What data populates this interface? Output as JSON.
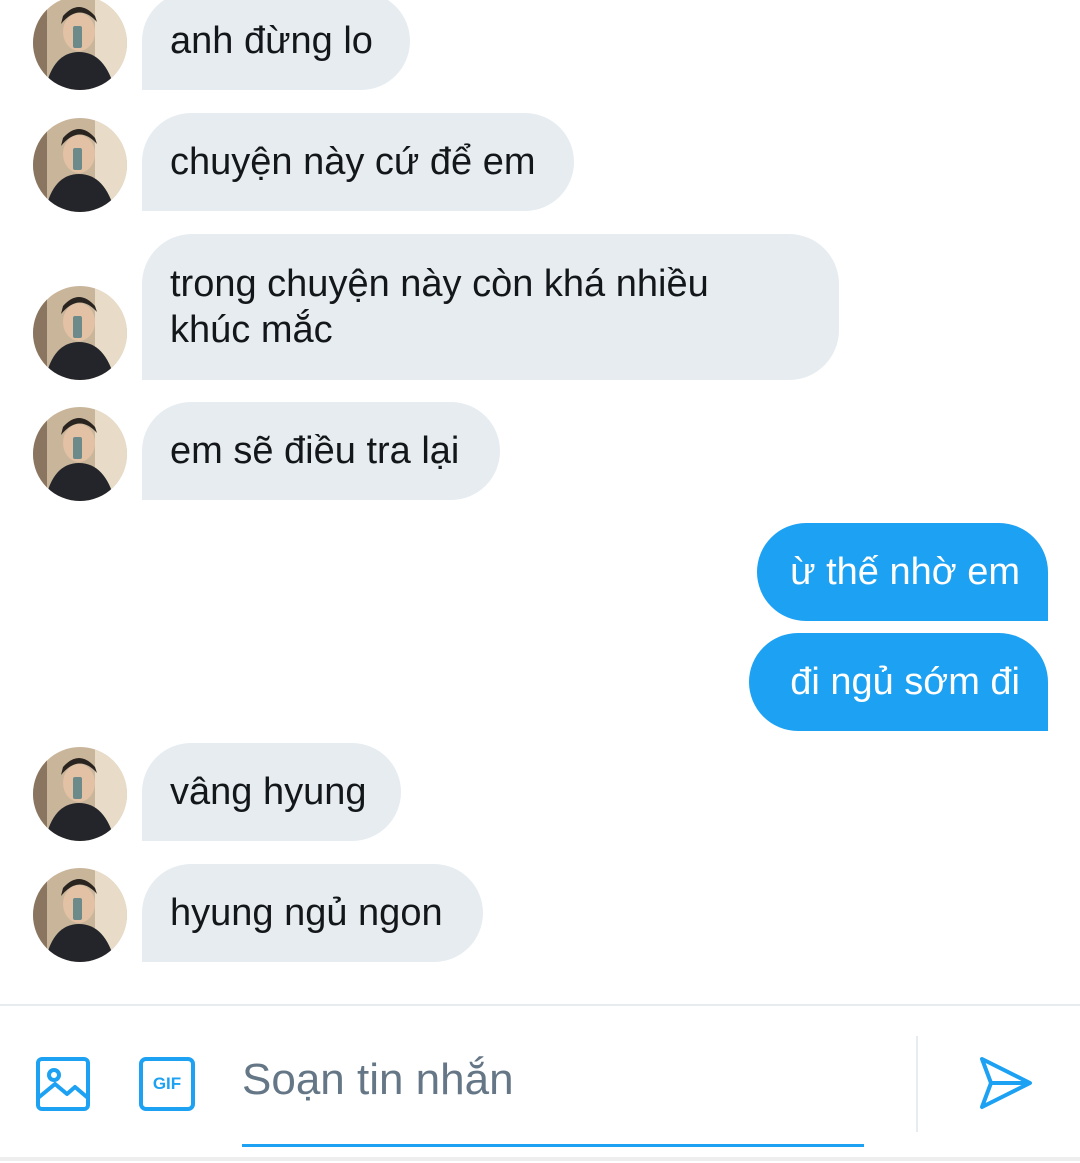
{
  "conversation": {
    "messages": [
      {
        "direction": "incoming",
        "text": "anh đừng lo"
      },
      {
        "direction": "incoming",
        "text": "chuyện này cứ để em"
      },
      {
        "direction": "incoming",
        "text": "trong chuyện này còn khá nhiều\nkhúc mắc"
      },
      {
        "direction": "incoming",
        "text": "em sẽ điều tra lại"
      },
      {
        "direction": "outgoing",
        "text": "ừ thế nhờ em"
      },
      {
        "direction": "outgoing",
        "text": "đi ngủ sớm đi"
      },
      {
        "direction": "incoming",
        "text": "vâng hyung"
      },
      {
        "direction": "incoming",
        "text": "hyung ngủ ngon"
      }
    ]
  },
  "composer": {
    "placeholder": "Soạn tin nhắn",
    "value": "",
    "image_icon": "image-icon",
    "gif_label": "GIF",
    "send_icon": "send-icon"
  },
  "colors": {
    "accent": "#1da1f2",
    "incoming_bubble": "#e6ecf0",
    "placeholder": "#657786"
  }
}
